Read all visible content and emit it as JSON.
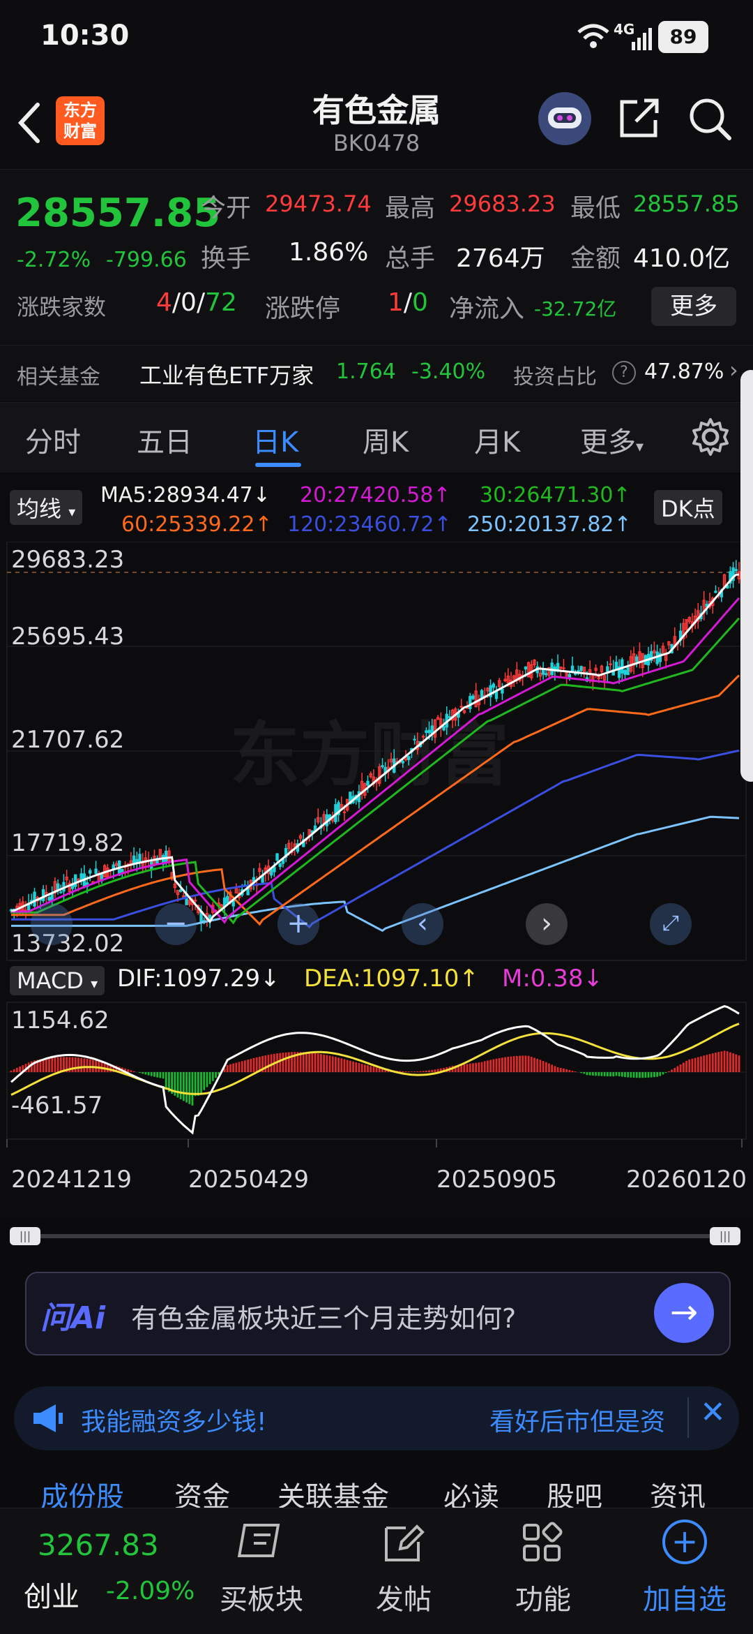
{
  "status_bar": {
    "time": "10:30",
    "network": "4G",
    "battery": "89"
  },
  "header": {
    "title": "有色金属",
    "code": "BK0478",
    "logo_text_1": "东方",
    "logo_text_2": "财富"
  },
  "quote": {
    "price": "28557.85",
    "change_pct": "-2.72%",
    "change_val": "-799.66",
    "open_label": "今开",
    "open": "29473.74",
    "high_label": "最高",
    "high": "29683.23",
    "low_label": "最低",
    "low": "28557.85",
    "turnover_label": "换手",
    "turnover": "1.86%",
    "volume_label": "总手",
    "volume": "2764万",
    "amount_label": "金额",
    "amount": "410.0亿",
    "updown_label": "涨跌家数",
    "up": "4",
    "flat": "0",
    "down": "72",
    "sep": "/",
    "limit_label": "涨跌停",
    "limit_up": "1",
    "limit_down": "0",
    "netflow_label": "净流入",
    "netflow": "-32.72亿",
    "more_button": "更多"
  },
  "fund": {
    "label": "相关基金",
    "name": "工业有色ETF万家",
    "price": "1.764",
    "change": "-3.40%",
    "ratio_label": "投资占比",
    "ratio": "47.87%"
  },
  "tabs": [
    {
      "label": "分时"
    },
    {
      "label": "五日"
    },
    {
      "label": "日K"
    },
    {
      "label": "周K"
    },
    {
      "label": "月K"
    },
    {
      "label": "更多"
    }
  ],
  "ma_bar": {
    "selector": "均线",
    "ma5": "MA5:28934.47↓",
    "ma20": "20:27420.58↑",
    "ma30": "30:26471.30↑",
    "ma60": "60:25339.22↑",
    "ma120": "120:23460.72↑",
    "ma250": "250:20137.82↑",
    "dk": "DK点"
  },
  "price_axis": [
    "29683.23",
    "25695.43",
    "21707.62",
    "17719.82",
    "13732.02"
  ],
  "macd": {
    "selector": "MACD",
    "dif": "DIF:1097.29↓",
    "dea": "DEA:1097.10↑",
    "m": "M:0.38↓",
    "top": "1154.62",
    "bottom": "-461.57"
  },
  "dates": [
    "20241219",
    "20250429",
    "20250905",
    "20260120"
  ],
  "watermark": "东方财富",
  "ai": {
    "logo": "问Ai",
    "prompt": "有色金属板块近三个月走势如何?"
  },
  "ticker": {
    "left": "我能融资多少钱!",
    "right": "看好后市但是资"
  },
  "sub_tabs": [
    {
      "label": "成份股"
    },
    {
      "label": "资金"
    },
    {
      "label": "关联基金"
    },
    {
      "label": "必读"
    },
    {
      "label": "股吧"
    },
    {
      "label": "资讯"
    }
  ],
  "bottom_nav": {
    "index_value": "3267.83",
    "index_name": "创业",
    "index_change": "-2.09%",
    "buy": "买板块",
    "post": "发帖",
    "func": "功能",
    "add": "加自选"
  },
  "colors": {
    "up": "#ff3b3b",
    "down": "#21c43a",
    "accent": "#3c8bff",
    "ma5": "#ffffff",
    "ma20": "#d41ad4",
    "ma30": "#1fb81f",
    "ma60": "#ff6a1a",
    "ma120": "#3a4fe0",
    "ma250": "#7cc4ff"
  }
}
